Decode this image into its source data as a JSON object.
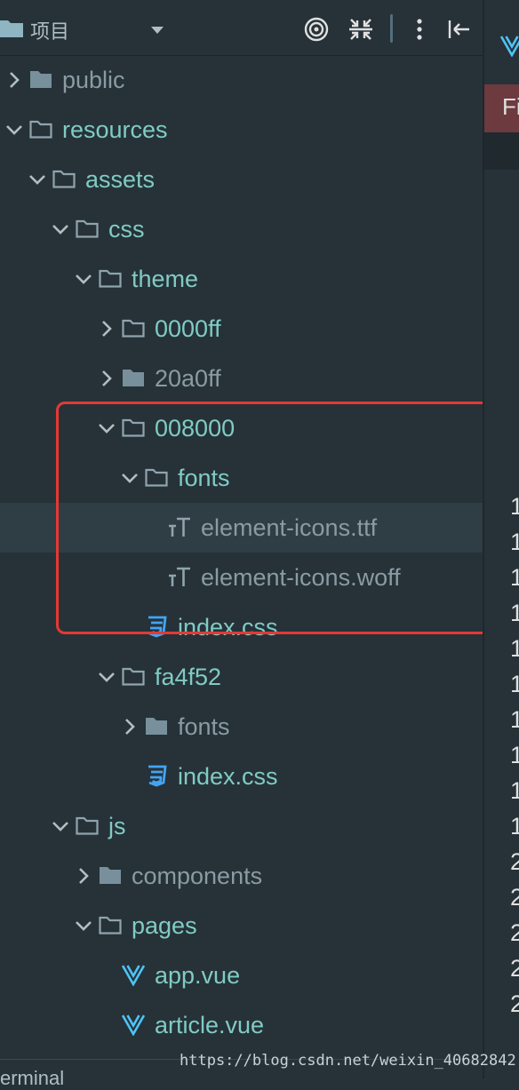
{
  "header": {
    "title": "项目"
  },
  "tree": [
    {
      "label": "public",
      "kind": "folder-closed",
      "expanded": false,
      "dim": false
    },
    {
      "label": "resources",
      "kind": "folder-open",
      "expanded": true,
      "dim": false
    },
    {
      "label": "assets",
      "kind": "folder-open",
      "expanded": true,
      "dim": false
    },
    {
      "label": "css",
      "kind": "folder-open",
      "expanded": true,
      "dim": false
    },
    {
      "label": "theme",
      "kind": "folder-open",
      "expanded": true,
      "dim": false
    },
    {
      "label": "0000ff",
      "kind": "folder-open",
      "expanded": false,
      "dim": false
    },
    {
      "label": "20a0ff",
      "kind": "folder-closed",
      "expanded": false,
      "dim": true
    },
    {
      "label": "008000",
      "kind": "folder-open",
      "expanded": true,
      "dim": false
    },
    {
      "label": "fonts",
      "kind": "folder-open",
      "expanded": true,
      "dim": false
    },
    {
      "label": "element-icons.ttf",
      "kind": "font-file",
      "selected": true
    },
    {
      "label": "element-icons.woff",
      "kind": "font-file"
    },
    {
      "label": "index.css",
      "kind": "css-file"
    },
    {
      "label": "fa4f52",
      "kind": "folder-open",
      "expanded": true,
      "dim": false
    },
    {
      "label": "fonts",
      "kind": "folder-closed",
      "expanded": false,
      "dim": true
    },
    {
      "label": "index.css",
      "kind": "css-file"
    },
    {
      "label": "js",
      "kind": "folder-open",
      "expanded": true,
      "dim": false
    },
    {
      "label": "components",
      "kind": "folder-closed",
      "expanded": false,
      "dim": true
    },
    {
      "label": "pages",
      "kind": "folder-open",
      "expanded": true,
      "dim": false
    },
    {
      "label": "app.vue",
      "kind": "vue-file"
    },
    {
      "label": "article.vue",
      "kind": "vue-file"
    }
  ],
  "editor": {
    "find_label": "Fi",
    "line_numbers": [
      "1",
      "1",
      "1",
      "1",
      "1",
      "1",
      "1",
      "1",
      "1",
      "1",
      "2",
      "2",
      "2",
      "2",
      "2"
    ]
  },
  "bottom": {
    "terminal_label": "erminal"
  },
  "watermark": "https://blog.csdn.net/weixin_40682842",
  "colors": {
    "background": "#263238",
    "folder_text": "#80cbc4",
    "dim_text": "#8a9ba3",
    "highlight_border": "#e53935",
    "selected_row": "#2f3d44",
    "find_bar": "#6d3a3f"
  }
}
